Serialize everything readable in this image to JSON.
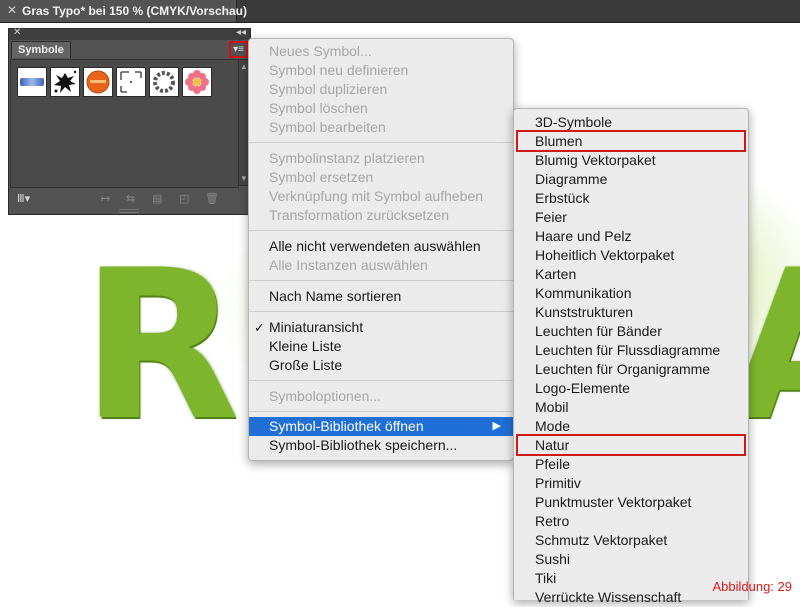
{
  "window": {
    "title": "Gras Typo* bei 150 % (CMYK/Vorschau)"
  },
  "panel": {
    "title": "Symbole"
  },
  "canvas_letters": {
    "first": "R",
    "second": "A"
  },
  "context_menu": {
    "items": [
      "Neues Symbol...",
      "Symbol neu definieren",
      "Symbol duplizieren",
      "Symbol löschen",
      "Symbol bearbeiten",
      "Symbolinstanz platzieren",
      "Symbol ersetzen",
      "Verknüpfung mit Symbol aufheben",
      "Transformation zurücksetzen",
      "Alle nicht verwendeten auswählen",
      "Alle Instanzen auswählen",
      "Nach Name sortieren",
      "Miniaturansicht",
      "Kleine Liste",
      "Große Liste",
      "Symboloptionen...",
      "Symbol-Bibliothek öffnen",
      "Symbol-Bibliothek speichern..."
    ],
    "checked_item": "Miniaturansicht",
    "highlighted_item": "Symbol-Bibliothek öffnen"
  },
  "submenu": {
    "items": [
      "3D-Symbole",
      "Blumen",
      "Blumig Vektorpaket",
      "Diagramme",
      "Erbstück",
      "Feier",
      "Haare und Pelz",
      "Hoheitlich Vektorpaket",
      "Karten",
      "Kommunikation",
      "Kunststrukturen",
      "Leuchten für Bänder",
      "Leuchten für Flussdiagramme",
      "Leuchten für Organigramme",
      "Logo-Elemente",
      "Mobil",
      "Mode",
      "Natur",
      "Pfeile",
      "Primitiv",
      "Punktmuster Vektorpaket",
      "Retro",
      "Schmutz Vektorpaket",
      "Sushi",
      "Tiki",
      "Verrückte Wissenschaft"
    ],
    "outlined_items": [
      "Blumen",
      "Natur"
    ]
  },
  "caption": "Abbildung: 29",
  "colors": {
    "highlight": "#1f6fd6",
    "annotation_red": "#cc1a1a",
    "grass_green": "#7db52c"
  }
}
